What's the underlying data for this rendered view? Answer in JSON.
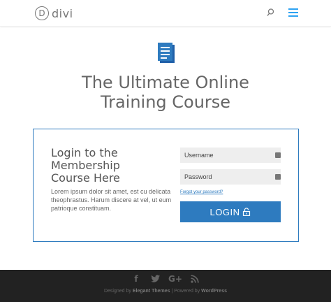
{
  "header": {
    "logo_mark": "D",
    "logo_text": "divi",
    "search_icon": "search-icon",
    "menu_icon": "hamburger-menu-icon",
    "accent_color": "#2ea3f2"
  },
  "hero": {
    "icon": "document-icon",
    "title_line1": "The Ultimate Online",
    "title_line2": "Training Course"
  },
  "login": {
    "title_line1": "Login to the",
    "title_line2": "Membership",
    "title_line3": "Course Here",
    "description": "Lorem ipsum dolor sit amet, est cu delicata theophrastus. Harum discere at vel, ut eum patrioque constituam.",
    "username_placeholder": "Username",
    "password_placeholder": "Password",
    "forgot_password": "Forgot your password?",
    "button_label": "LOGIN",
    "brand_color": "#2e7bbf"
  },
  "footer": {
    "social_icons": [
      "facebook-icon",
      "twitter-icon",
      "google-plus-icon",
      "rss-icon"
    ],
    "designed_by_prefix": "Designed by ",
    "designed_by_name": "Elegant Themes",
    "powered_separator": " | Powered by ",
    "powered_by_name": "WordPress"
  }
}
